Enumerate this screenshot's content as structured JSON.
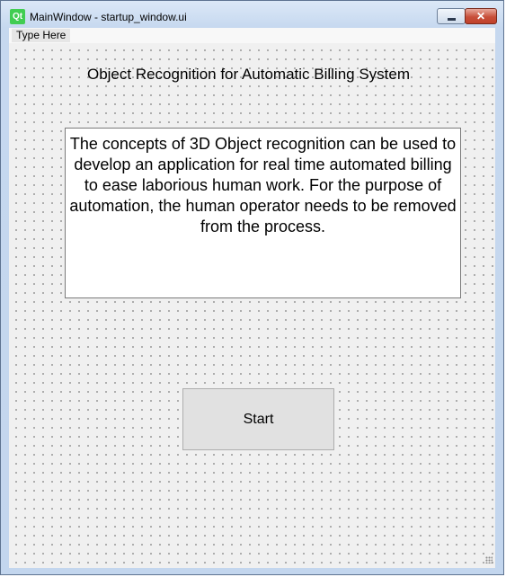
{
  "window": {
    "title": "MainWindow - startup_window.ui",
    "app_logo": "Qt",
    "minimize_icon": "minimize-icon",
    "close_icon": "close-icon",
    "close_glyph": "✕"
  },
  "menubar": {
    "items": [
      {
        "label": "Type Here"
      }
    ]
  },
  "main": {
    "heading": "Object Recognition for Automatic Billing System",
    "description": "The concepts of 3D Object recognition can be used to develop an application for real time automated billing to ease laborious human work. For the purpose of automation, the human operator needs to be removed from the process.",
    "start_label": "Start"
  },
  "colors": {
    "qt_green": "#41cd52",
    "close_red": "#c8503a",
    "canvas_bg": "#f0f0f0"
  }
}
